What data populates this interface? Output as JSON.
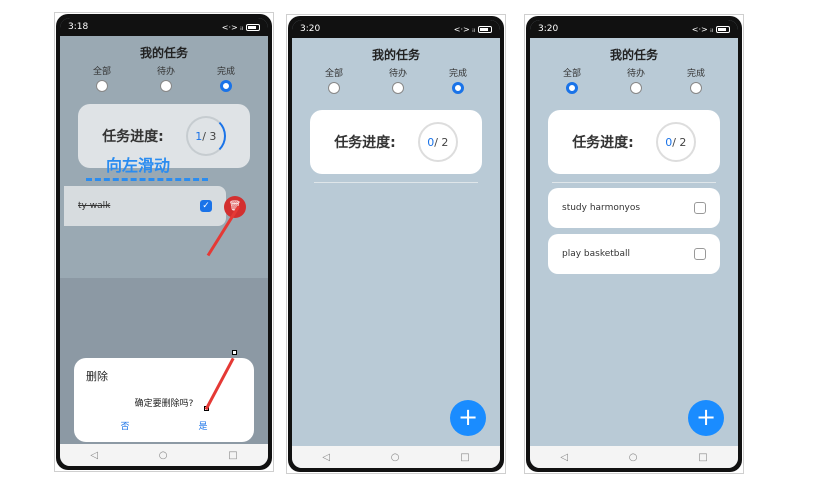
{
  "screens": [
    {
      "time": "3:18",
      "title": "我的任务",
      "tabs": [
        "全部",
        "待办",
        "完成"
      ],
      "active_tab": 2,
      "progress_label": "任务进度:",
      "progress_done": "1",
      "progress_total": "/ 3",
      "swipe_hint": "向左滑动",
      "task": "ty walk",
      "dialog_title": "删除",
      "dialog_message": "确定要删除吗?",
      "dialog_no": "否",
      "dialog_yes": "是"
    },
    {
      "time": "3:20",
      "title": "我的任务",
      "tabs": [
        "全部",
        "待办",
        "完成"
      ],
      "active_tab": 2,
      "progress_label": "任务进度:",
      "progress_done": "0",
      "progress_total": "/ 2"
    },
    {
      "time": "3:20",
      "title": "我的任务",
      "tabs": [
        "全部",
        "待办",
        "完成"
      ],
      "active_tab": 0,
      "progress_label": "任务进度:",
      "progress_done": "0",
      "progress_total": "/ 2",
      "tasks": [
        "study harmonyos",
        "play basketball"
      ]
    }
  ],
  "icons": {
    "add": "+",
    "delete": "🗑",
    "back": "◁",
    "home": "○",
    "recent": "□"
  }
}
